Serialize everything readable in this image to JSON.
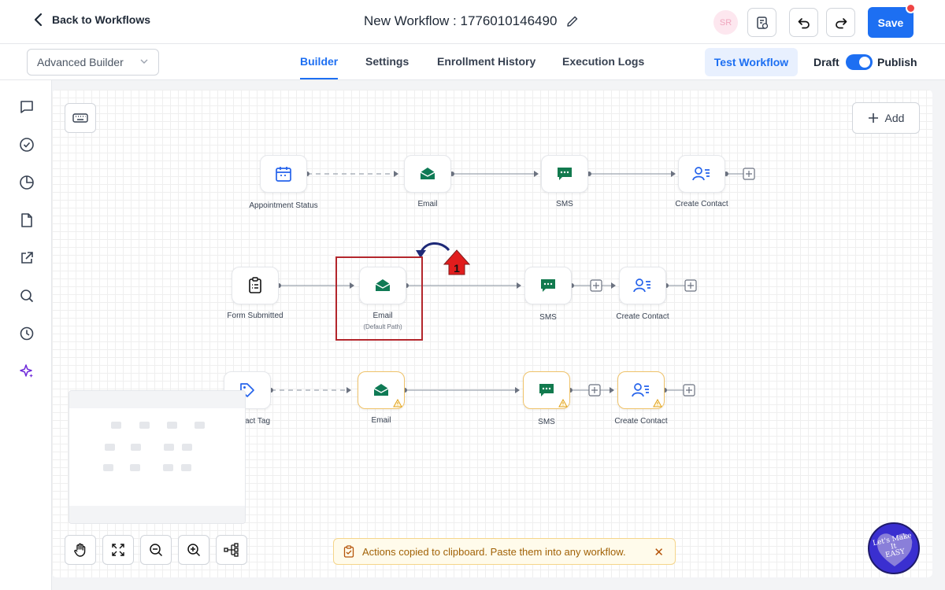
{
  "header": {
    "back_label": "Back to Workflows",
    "title": "New Workflow : 1776010146490",
    "avatar_initials": "SR",
    "save_label": "Save"
  },
  "subheader": {
    "builder_mode": "Advanced Builder",
    "tabs": [
      {
        "label": "Builder",
        "active": true
      },
      {
        "label": "Settings",
        "active": false
      },
      {
        "label": "Enrollment History",
        "active": false
      },
      {
        "label": "Execution Logs",
        "active": false
      }
    ],
    "test_workflow_label": "Test Workflow",
    "draft_label": "Draft",
    "publish_label": "Publish",
    "publish_toggle_on": true
  },
  "sidebar": {
    "icons": [
      "chat-icon",
      "check-circle-icon",
      "pie-chart-icon",
      "file-icon",
      "external-link-icon",
      "search-icon",
      "history-icon",
      "sparkle-icon"
    ]
  },
  "canvas": {
    "add_label": "Add",
    "rows": [
      {
        "nodes": [
          {
            "label": "Appointment Status",
            "icon": "calendar-icon"
          },
          {
            "label": "Email",
            "icon": "email-icon"
          },
          {
            "label": "SMS",
            "icon": "sms-icon"
          },
          {
            "label": "Create Contact",
            "icon": "create-contact-icon"
          }
        ]
      },
      {
        "nodes": [
          {
            "label": "Form Submitted",
            "icon": "form-icon"
          },
          {
            "label": "Email",
            "sublabel": "(Default Path)",
            "icon": "email-icon"
          },
          {
            "label": "SMS",
            "icon": "sms-icon"
          },
          {
            "label": "Create Contact",
            "icon": "create-contact-icon"
          }
        ]
      },
      {
        "nodes": [
          {
            "label": "act Tag",
            "icon": "tag-icon"
          },
          {
            "label": "Email",
            "icon": "email-icon",
            "warning": true
          },
          {
            "label": "SMS",
            "icon": "sms-icon",
            "warning": true
          },
          {
            "label": "Create Contact",
            "icon": "create-contact-icon",
            "warning": true
          }
        ]
      }
    ],
    "annotation_number": "1"
  },
  "controls": [
    "hand-icon",
    "fit-view-icon",
    "zoom-out-icon",
    "zoom-in-icon",
    "layout-icon"
  ],
  "toast": {
    "message": "Actions copied to clipboard. Paste them into any workflow.",
    "close": "✕"
  },
  "badge": {
    "text_line1": "Let's Make",
    "text_line2": "It",
    "text_line3": "EASY"
  },
  "colors": {
    "primary": "#1d6ff2",
    "email_green": "#0f7a55",
    "sms_green": "#127a4e",
    "contact_blue": "#2563eb",
    "warning": "#f0b429",
    "highlight_red": "#b3262c"
  }
}
